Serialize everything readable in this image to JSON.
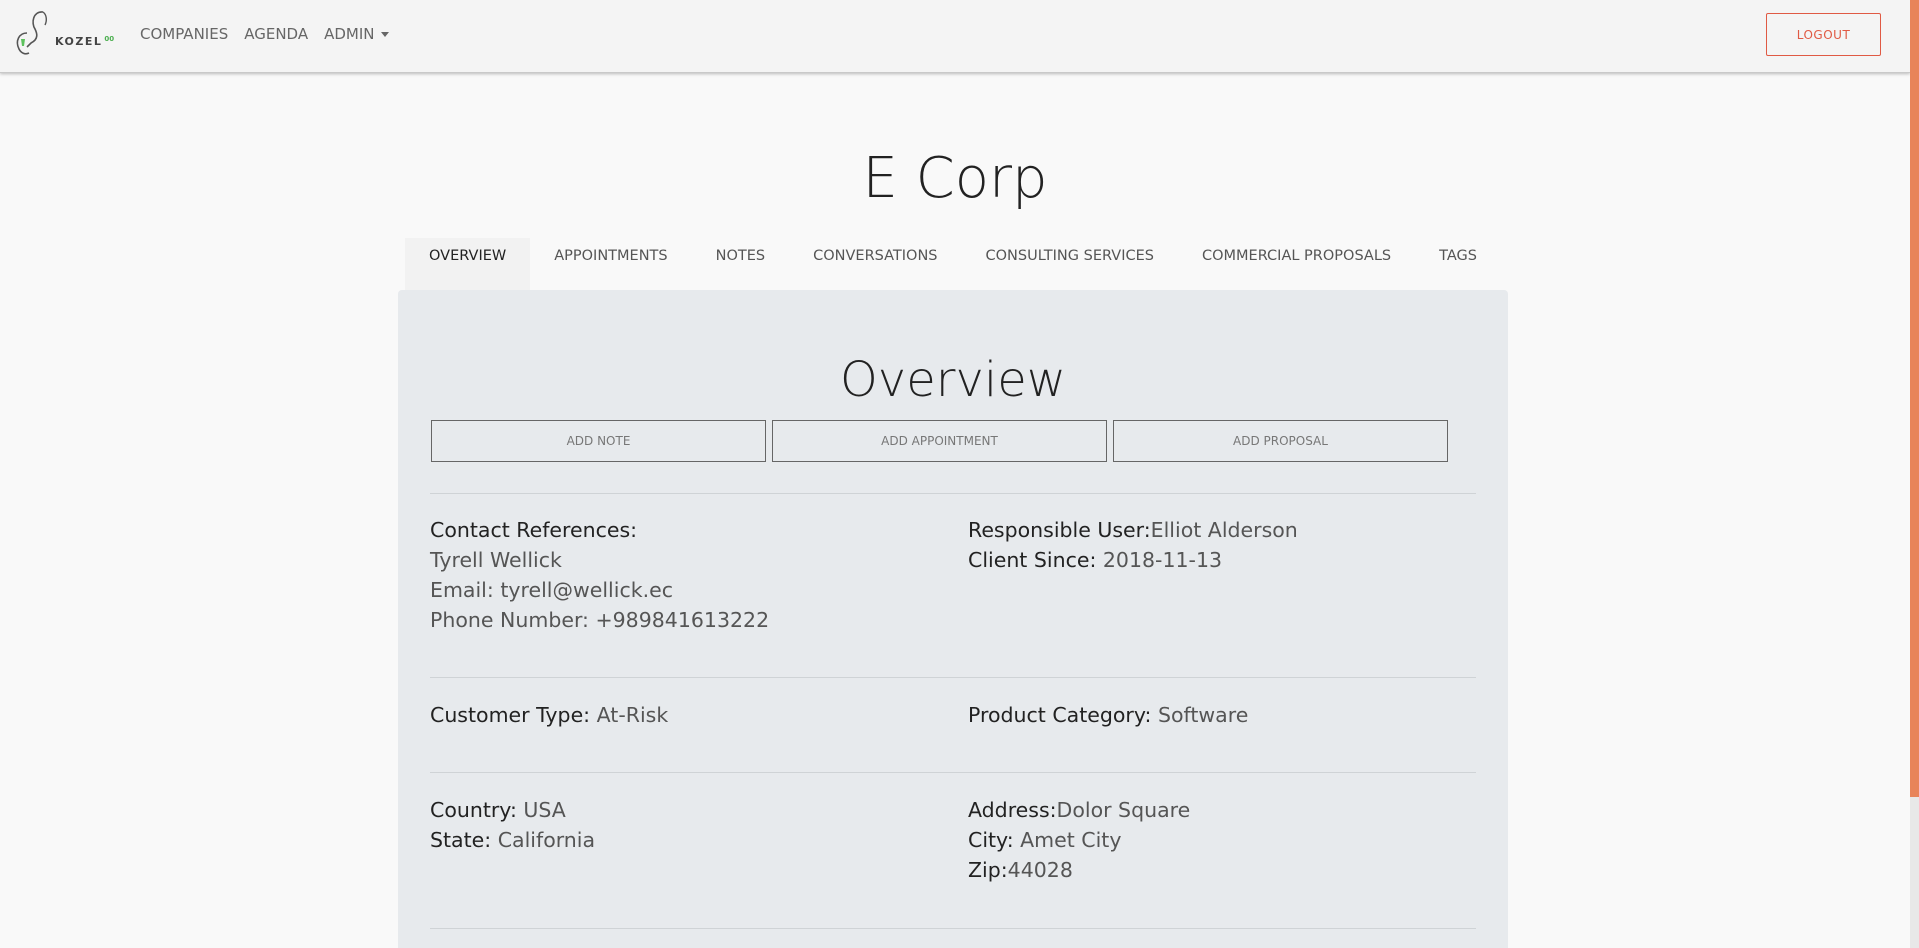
{
  "nav": {
    "brand": "KOZEL",
    "brand_sub": "00",
    "links": [
      "COMPANIES",
      "AGENDA",
      "ADMIN"
    ],
    "logout_label": "LOGOUT"
  },
  "company": {
    "name": "E Corp"
  },
  "tabs": [
    "OVERVIEW",
    "APPOINTMENTS",
    "NOTES",
    "CONVERSATIONS",
    "CONSULTING SERVICES",
    "COMMERCIAL PROPOSALS",
    "TAGS"
  ],
  "overview": {
    "title": "Overview",
    "buttons": {
      "add_note": "ADD NOTE",
      "add_appointment": "ADD APPOINTMENT",
      "add_proposal": "ADD PROPOSAL"
    },
    "contact": {
      "label": "Contact References:",
      "name": "Tyrell Wellick",
      "email_label": "Email:",
      "email": "tyrell@wellick.ec",
      "phone_label": "Phone Number:",
      "phone": "+989841613222"
    },
    "responsible": {
      "label": "Responsible User:",
      "value": "Elliot Alderson"
    },
    "client_since": {
      "label": "Client Since:",
      "value": "2018-11-13"
    },
    "customer_type": {
      "label": "Customer Type:",
      "value": "At-Risk"
    },
    "product_category": {
      "label": "Product Category:",
      "value": "Software"
    },
    "country": {
      "label": "Country:",
      "value": "USA"
    },
    "state": {
      "label": "State:",
      "value": "California"
    },
    "address": {
      "label": "Address:",
      "value": "Dolor Square"
    },
    "city": {
      "label": "City:",
      "value": "Amet City"
    },
    "zip": {
      "label": "Zip:",
      "value": "44028"
    }
  },
  "colors": {
    "accent": "#e05a44",
    "scrollbar": "#e8845a",
    "panel": "#e7eaed"
  }
}
